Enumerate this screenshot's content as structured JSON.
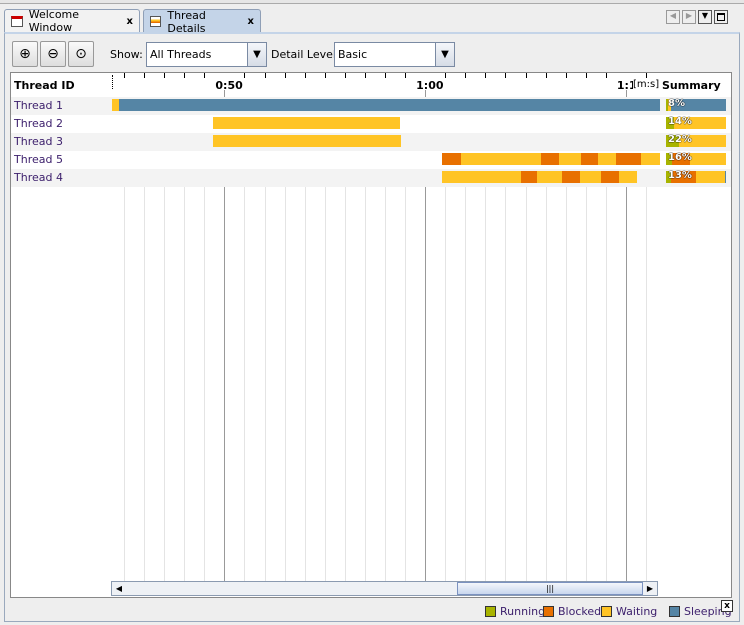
{
  "tabs": [
    {
      "label": "Welcome Window",
      "close": "x"
    },
    {
      "label": "Thread Details",
      "close": "x",
      "active": true
    }
  ],
  "toolbar": {
    "show_label": "Show:",
    "show_value": "All Threads",
    "detail_label": "Detail Level:",
    "detail_value": "Basic",
    "zoom_in": "zoom-in",
    "zoom_out": "zoom-out",
    "zoom_fit": "zoom-fit"
  },
  "header": {
    "thread_id": "Thread ID",
    "summary": "Summary",
    "unit": "[m:s]",
    "ticks": [
      {
        "label": "0:50",
        "t": 50
      },
      {
        "label": "1:00",
        "t": 60
      },
      {
        "label": "1:1",
        "t": 70
      }
    ]
  },
  "time_range": [
    44.4,
    71.7
  ],
  "colors": {
    "running": "#a8b400",
    "blocked": "#e87000",
    "waiting": "#ffc425",
    "sleeping": "#5585a5"
  },
  "threads": [
    {
      "name": "Thread 1",
      "summary": "8%",
      "mix": {
        "running": 3,
        "waiting": 5,
        "sleeping": 92
      },
      "segments": [
        [
          "waiting",
          44.4,
          44.75
        ],
        [
          "sleeping",
          44.75,
          71.7
        ]
      ]
    },
    {
      "name": "Thread 2",
      "summary": "14%",
      "mix": {
        "running": 14,
        "waiting": 86
      },
      "segments": [
        [
          "waiting",
          49.45,
          58.73
        ]
      ]
    },
    {
      "name": "Thread 3",
      "summary": "22%",
      "mix": {
        "running": 22,
        "waiting": 78
      },
      "segments": [
        [
          "waiting",
          49.45,
          58.78
        ]
      ]
    },
    {
      "name": "Thread 5",
      "summary": "16%",
      "mix": {
        "running": 10,
        "blocked": 30,
        "waiting": 60
      },
      "segments": [
        [
          "blocked",
          60.82,
          61.77
        ],
        [
          "waiting",
          61.77,
          65.76
        ],
        [
          "blocked",
          65.76,
          66.66
        ],
        [
          "waiting",
          66.66,
          67.76
        ],
        [
          "blocked",
          67.76,
          68.6
        ],
        [
          "waiting",
          68.6,
          69.5
        ],
        [
          "blocked",
          69.5,
          70.75
        ],
        [
          "waiting",
          70.75,
          71.7
        ]
      ]
    },
    {
      "name": "Thread 4",
      "summary": "13%",
      "mix": {
        "running": 8,
        "blocked": 42,
        "waiting": 48,
        "sleeping": 2
      },
      "segments": [
        [
          "waiting",
          60.82,
          64.76
        ],
        [
          "blocked",
          64.76,
          65.56
        ],
        [
          "waiting",
          65.56,
          66.81
        ],
        [
          "blocked",
          66.81,
          67.71
        ],
        [
          "waiting",
          67.71,
          68.75
        ],
        [
          "blocked",
          68.75,
          69.65
        ],
        [
          "waiting",
          69.65,
          70.55
        ]
      ]
    }
  ],
  "legend": [
    {
      "key": "running",
      "label": "Running"
    },
    {
      "key": "blocked",
      "label": "Blocked"
    },
    {
      "key": "waiting",
      "label": "Waiting"
    },
    {
      "key": "sleeping",
      "label": "Sleeping"
    }
  ],
  "legend_close": "x"
}
